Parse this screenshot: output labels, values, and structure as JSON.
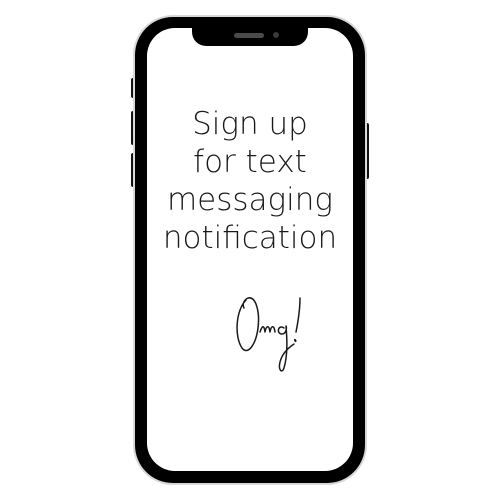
{
  "phone": {
    "frame_color": "#000000",
    "screen_color": "#ffffff"
  },
  "screen": {
    "lines": [
      "Sign up",
      "for text",
      "messaging",
      "notification"
    ],
    "signature_text": "Omg!"
  }
}
